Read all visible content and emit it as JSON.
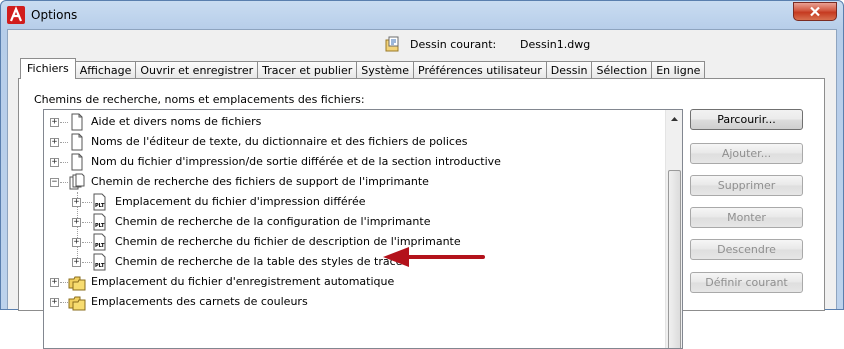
{
  "window": {
    "title": "Options"
  },
  "drawing": {
    "label": "Dessin courant:",
    "value": "Dessin1.dwg"
  },
  "tabs": [
    {
      "label": "Fichiers",
      "active": true
    },
    {
      "label": "Affichage",
      "active": false
    },
    {
      "label": "Ouvrir et enregistrer",
      "active": false
    },
    {
      "label": "Tracer et publier",
      "active": false
    },
    {
      "label": "Système",
      "active": false
    },
    {
      "label": "Préférences utilisateur",
      "active": false
    },
    {
      "label": "Dessin",
      "active": false
    },
    {
      "label": "Sélection",
      "active": false
    },
    {
      "label": "En ligne",
      "active": false
    }
  ],
  "section": {
    "label": "Chemins de recherche, noms et emplacements des fichiers:"
  },
  "tree": [
    {
      "label": "Aide et divers noms de fichiers",
      "level": 0,
      "icon": "document-icon",
      "expander": "+"
    },
    {
      "label": "Noms de l'éditeur de texte, du dictionnaire et des fichiers de polices",
      "level": 0,
      "icon": "document-icon",
      "expander": "+"
    },
    {
      "label": "Nom du fichier d'impression/de sortie différée et de la section introductive",
      "level": 0,
      "icon": "document-icon",
      "expander": "+"
    },
    {
      "label": "Chemin de recherche des fichiers de support de l'imprimante",
      "level": 0,
      "icon": "document-stack-icon",
      "expander": "-"
    },
    {
      "label": "Emplacement du fichier d'impression différée",
      "level": 1,
      "icon": "plt-file-icon",
      "expander": "+"
    },
    {
      "label": "Chemin de recherche de la configuration de l'imprimante",
      "level": 1,
      "icon": "plt-file-icon",
      "expander": "+"
    },
    {
      "label": "Chemin de recherche du fichier de description de l'imprimante",
      "level": 1,
      "icon": "plt-file-icon",
      "expander": "+"
    },
    {
      "label": "Chemin de recherche de la table des styles de tracé",
      "level": 1,
      "icon": "plt-file-icon",
      "expander": "+"
    },
    {
      "label": "Emplacement du fichier d'enregistrement automatique",
      "level": 0,
      "icon": "folder-stack-icon",
      "expander": "+"
    },
    {
      "label": "Emplacements des carnets de couleurs",
      "level": 0,
      "icon": "folder-stack-icon",
      "expander": "+"
    }
  ],
  "buttons": {
    "browse": {
      "label": "Parcourir...",
      "enabled": true
    },
    "add": {
      "label": "Ajouter...",
      "enabled": false
    },
    "remove": {
      "label": "Supprimer",
      "enabled": false
    },
    "move_up": {
      "label": "Monter",
      "enabled": false
    },
    "move_down": {
      "label": "Descendre",
      "enabled": false
    },
    "set_current": {
      "label": "Définir courant",
      "enabled": false
    }
  },
  "colors": {
    "annotation_arrow": "#b3121b",
    "close_button": "#c9452b"
  }
}
